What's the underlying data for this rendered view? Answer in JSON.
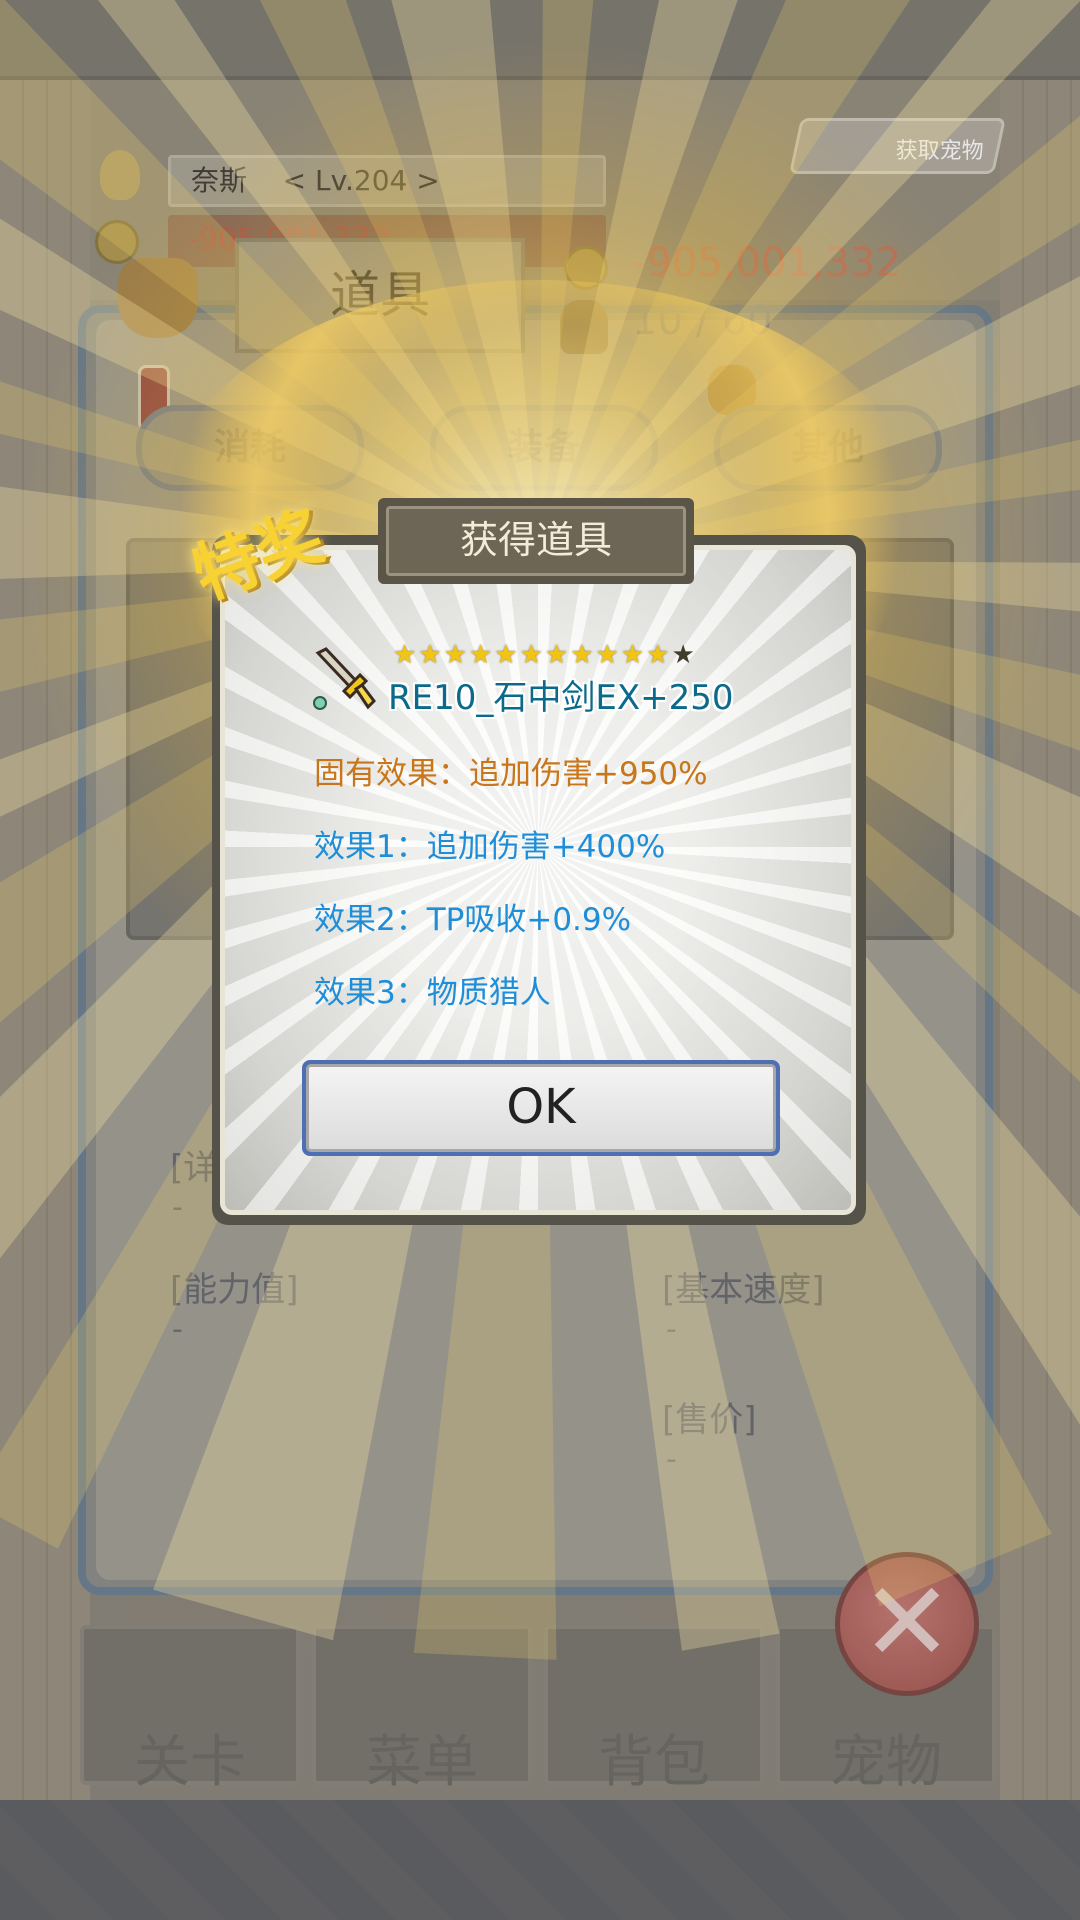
{
  "hud": {
    "player_name": "奈斯",
    "player_level": "< Lv.204 >",
    "gold_partial": "-905,001,332",
    "get_pets_label": "获取宠物"
  },
  "inventory": {
    "title": "道具",
    "money": "-905,001,332",
    "capacity": "10 / 60",
    "tabs": [
      "消耗",
      "装备",
      "其他"
    ],
    "details_label": "[详",
    "details_value": "-",
    "stats": {
      "ability_label": "[能力值]",
      "ability_value": "-",
      "speed_label": "[基本速度]",
      "speed_value": "-",
      "price_label": "[售价]",
      "price_value": "-"
    }
  },
  "bottom_nav": [
    "关卡",
    "菜单",
    "背包",
    "宠物"
  ],
  "dialog": {
    "title": "获得道具",
    "badge": "特奖",
    "stars_filled": 11,
    "stars_total": 12,
    "item_name": "RE10_石中剑EX+250",
    "inherent_effect": "固有效果：追加伤害+950%",
    "effect1": "效果1：追加伤害+400%",
    "effect2": "效果2：TP吸收+0.9%",
    "effect3": "效果3：物质猎人",
    "ok_label": "OK"
  },
  "colors": {
    "inherent": "#c9761a",
    "effect": "#1f8ed8",
    "item_name": "#0b6a8a",
    "star": "#f2c515"
  },
  "icons": [
    "coin-icon",
    "bag-icon",
    "sword-icon",
    "potion-icon",
    "pouch-icon",
    "close-icon",
    "player-avatar-icon"
  ]
}
